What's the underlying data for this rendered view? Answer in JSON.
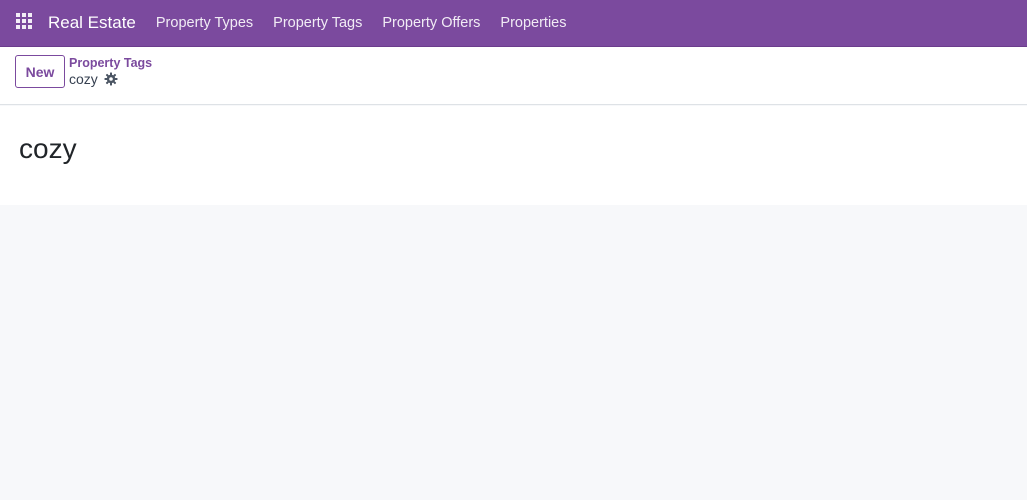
{
  "navbar": {
    "apps_icon": "apps-grid-icon",
    "brand": "Real Estate",
    "menu": [
      {
        "label": "Property Types"
      },
      {
        "label": "Property Tags"
      },
      {
        "label": "Property Offers"
      },
      {
        "label": "Properties"
      }
    ],
    "color": "#7b4a9e"
  },
  "control_panel": {
    "new_label": "New",
    "breadcrumb": {
      "parent": "Property Tags",
      "current": "cozy",
      "action_icon": "gear-icon"
    }
  },
  "form": {
    "name": "cozy"
  }
}
